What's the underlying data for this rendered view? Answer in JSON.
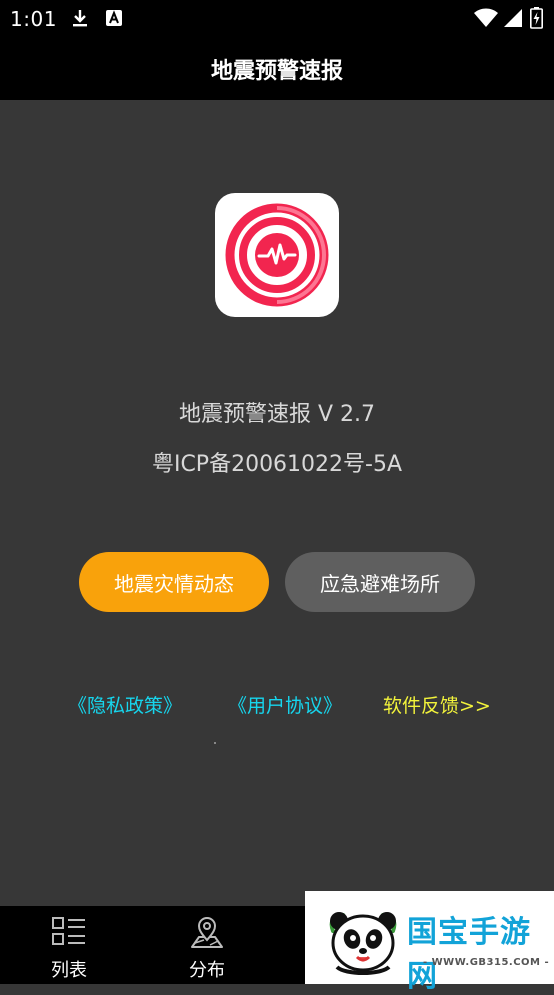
{
  "status_bar": {
    "time": "1:01",
    "icons": [
      "download-icon",
      "font-a-icon",
      "wifi-icon",
      "signal-icon",
      "battery-charging-icon"
    ]
  },
  "header": {
    "title": "地震预警速报"
  },
  "about": {
    "app_name_version": "地震预警速报  V 2.7",
    "icp": "粤ICP备20061022号-5A",
    "logo_icon": "earthquake-pulse-logo-icon",
    "logo_colors": {
      "ring": "#f2254f",
      "background": "#ffffff"
    }
  },
  "buttons": {
    "disaster_news": "地震灾情动态",
    "shelters": "应急避难场所",
    "colors": {
      "primary": "#f9a20b",
      "secondary": "#5f5f5f"
    }
  },
  "links": {
    "privacy": "《隐私政策》",
    "agreement": "《用户协议》",
    "feedback": "软件反馈>>"
  },
  "tab_bar": {
    "tabs": [
      {
        "label": "列表",
        "icon": "list-grid-icon"
      },
      {
        "label": "分布",
        "icon": "map-pin-icon"
      }
    ]
  },
  "watermark": {
    "brand": "国宝手游网",
    "url": "- WWW.GB315.COM -"
  }
}
